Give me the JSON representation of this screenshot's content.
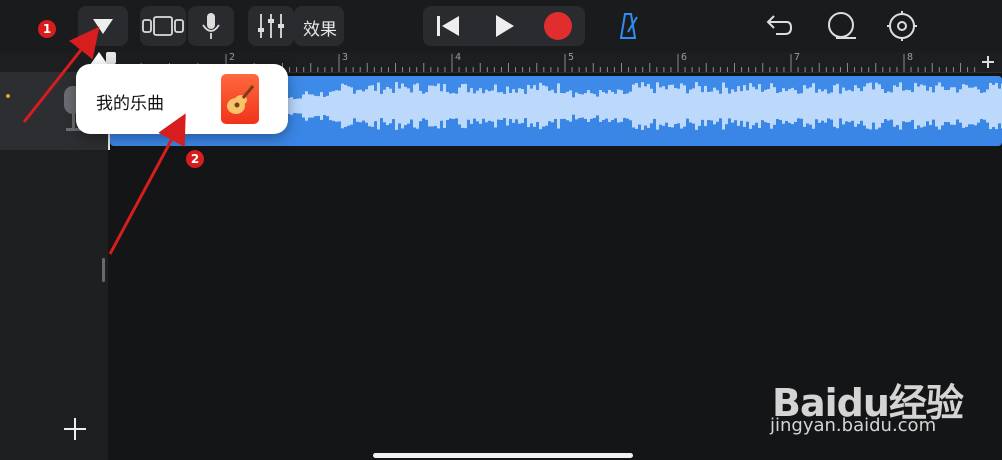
{
  "toolbar": {
    "effects_label": "效果",
    "icons": [
      "browser-dropdown-icon",
      "tracks-view-icon",
      "microphone-icon",
      "mixer-icon",
      "go-to-start-icon",
      "play-icon",
      "record-icon",
      "metronome-icon",
      "undo-icon",
      "loop-icon",
      "settings-icon"
    ],
    "record_color": "#e02d2d",
    "metronome_color": "#2f8df5"
  },
  "ruler": {
    "marks": [
      "2",
      "3",
      "4",
      "5",
      "6",
      "7",
      "8"
    ]
  },
  "track": {
    "region_color": "#3a86e6",
    "waveform_color": "#bcd8fb"
  },
  "popover": {
    "label": "我的乐曲"
  },
  "annotations": {
    "step1": "1",
    "step2": "2"
  },
  "watermark": {
    "brand": "Baidu经验",
    "url": "jingyan.baidu.com"
  }
}
